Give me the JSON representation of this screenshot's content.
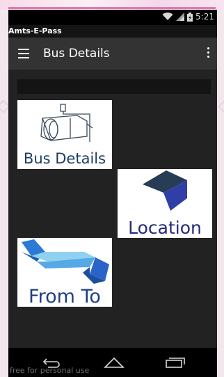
{
  "status_bar": {
    "time": "5:21",
    "icons": [
      "wifi-icon",
      "signal-icon",
      "battery-icon"
    ]
  },
  "window": {
    "title": "Amts-E-Pass"
  },
  "app_bar": {
    "title": "Bus Details",
    "menu_icon": "hamburger-menu-icon",
    "overflow_icon": "more-vert-icon"
  },
  "tiles": [
    {
      "label": "Bus Details",
      "icon": "bus-sketch-icon"
    },
    {
      "label": "Location",
      "icon": "location-cube-icon"
    },
    {
      "label": "From To",
      "icon": "from-to-arrows-icon"
    }
  ],
  "nav_bar": {
    "back_icon": "back-icon",
    "home_icon": "home-icon",
    "recents_icon": "recents-icon"
  },
  "watermark": "free for personal use",
  "colors": {
    "app_bar": "#333333",
    "content_bg": "#222222",
    "accent_pink": "#e27ab0",
    "tile_text_blue": "#1d3f73"
  }
}
